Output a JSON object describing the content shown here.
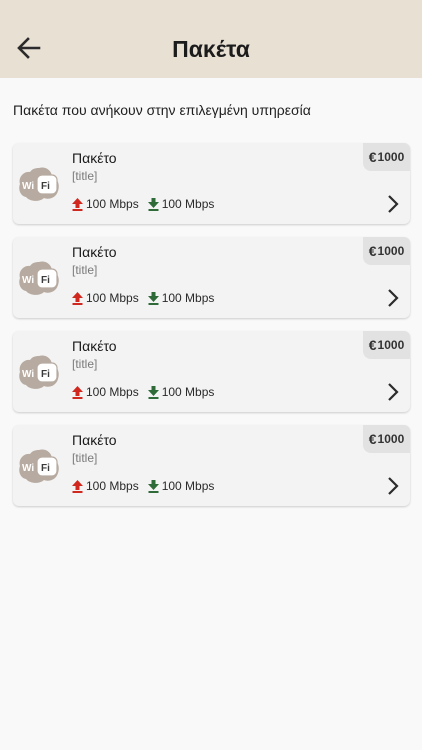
{
  "header": {
    "title": "Πακέτα",
    "back_icon": "arrow-left-icon"
  },
  "subtitle": "Πακέτα που ανήκουν στην επιλεγμένη υπηρεσία",
  "colors": {
    "header_bg": "#e9e0d4",
    "upload": "#d0281f",
    "download": "#2e6b39",
    "logo": "#b7aaa0"
  },
  "packages": [
    {
      "name": "Πακέτο",
      "title": "[title]",
      "upload": "100 Mbps",
      "download": "100 Mbps",
      "currency": "€",
      "price": "1000",
      "logo_left": "Wi",
      "logo_right": "Fi"
    },
    {
      "name": "Πακέτο",
      "title": "[title]",
      "upload": "100 Mbps",
      "download": "100 Mbps",
      "currency": "€",
      "price": "1000",
      "logo_left": "Wi",
      "logo_right": "Fi"
    },
    {
      "name": "Πακέτο",
      "title": "[title]",
      "upload": "100 Mbps",
      "download": "100 Mbps",
      "currency": "€",
      "price": "1000",
      "logo_left": "Wi",
      "logo_right": "Fi"
    },
    {
      "name": "Πακέτο",
      "title": "[title]",
      "upload": "100 Mbps",
      "download": "100 Mbps",
      "currency": "€",
      "price": "1000",
      "logo_left": "Wi",
      "logo_right": "Fi"
    }
  ]
}
